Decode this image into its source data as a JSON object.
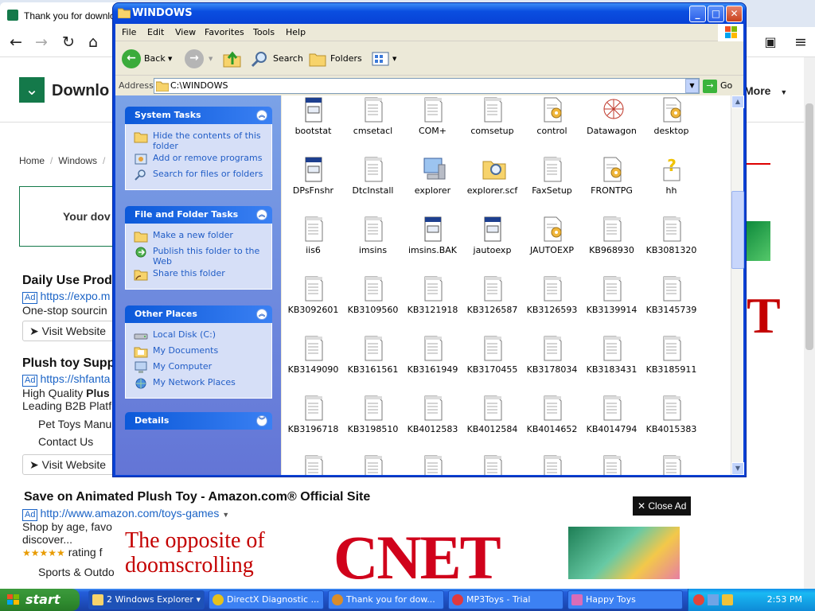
{
  "browser": {
    "tab_title": "Thank you for downloa",
    "logo_text": "Downlo",
    "more_label": "More",
    "breadcrumb": [
      "Home",
      "Windows"
    ],
    "download_box_text": "Your dov",
    "ads": [
      {
        "title": "Daily Use Prod",
        "url": "https://expo.m",
        "desc": "One-stop sourcin",
        "button": "Visit Website"
      },
      {
        "title": "Plush toy Supp",
        "url": "https://shfanta",
        "desc1_prefix": "High Quality ",
        "desc1_bold": "Plus",
        "desc2": "Leading B2B Platf",
        "link1": "Pet Toys Manu",
        "link2": "Contact Us",
        "button": "Visit Website"
      },
      {
        "title": "Save on Animated Plush Toy - Amazon.com® Official Site",
        "url": "http://www.amazon.com/toys-games",
        "desc1": "Shop by age, favo",
        "desc2": "discover...",
        "rating": "★★★★★",
        "rating_text": "rating f",
        "link1": "Sports & Outdo"
      }
    ],
    "close_ad": "Close Ad",
    "cnet_tagline_1": "The opposite of",
    "cnet_tagline_2": "doomscrolling",
    "cnet_logo": "CNET"
  },
  "explorer": {
    "title": "WINDOWS",
    "menu": [
      "File",
      "Edit",
      "View",
      "Favorites",
      "Tools",
      "Help"
    ],
    "toolbar": {
      "back": "Back",
      "search": "Search",
      "folders": "Folders"
    },
    "address_label": "Address",
    "address_value": "C:\\WINDOWS",
    "go_label": "Go",
    "system_tasks": {
      "title": "System Tasks",
      "items": [
        "Hide the contents of this folder",
        "Add or remove programs",
        "Search for files or folders"
      ]
    },
    "file_folder_tasks": {
      "title": "File and Folder Tasks",
      "items": [
        "Make a new folder",
        "Publish this folder to the Web",
        "Share this folder"
      ]
    },
    "other_places": {
      "title": "Other Places",
      "items": [
        "Local Disk (C:)",
        "My Documents",
        "My Computer",
        "My Network Places"
      ]
    },
    "details": {
      "title": "Details"
    },
    "files": [
      {
        "name": "bootstat",
        "icon": "log-file-icon"
      },
      {
        "name": "cmsetacl",
        "icon": "text-file-icon"
      },
      {
        "name": "COM+",
        "icon": "text-file-icon"
      },
      {
        "name": "comsetup",
        "icon": "text-file-icon"
      },
      {
        "name": "control",
        "icon": "settings-file-icon"
      },
      {
        "name": "Datawagon",
        "icon": "datawagon-icon"
      },
      {
        "name": "desktop",
        "icon": "settings-file-icon"
      },
      {
        "name": "DPsFnshr",
        "icon": "log-file-icon"
      },
      {
        "name": "DtcInstall",
        "icon": "text-file-icon"
      },
      {
        "name": "explorer",
        "icon": "computer-icon"
      },
      {
        "name": "explorer.scf",
        "icon": "search-folder-icon"
      },
      {
        "name": "FaxSetup",
        "icon": "text-file-icon"
      },
      {
        "name": "FRONTPG",
        "icon": "settings-file-icon"
      },
      {
        "name": "hh",
        "icon": "help-icon"
      },
      {
        "name": "iis6",
        "icon": "text-file-icon"
      },
      {
        "name": "imsins",
        "icon": "text-file-icon"
      },
      {
        "name": "imsins.BAK",
        "icon": "log-file-icon"
      },
      {
        "name": "jautoexp",
        "icon": "log-file-icon"
      },
      {
        "name": "JAUTOEXP",
        "icon": "settings-file-icon"
      },
      {
        "name": "KB968930",
        "icon": "text-file-icon"
      },
      {
        "name": "KB3081320",
        "icon": "text-file-icon"
      },
      {
        "name": "KB3092601",
        "icon": "text-file-icon"
      },
      {
        "name": "KB3109560",
        "icon": "text-file-icon"
      },
      {
        "name": "KB3121918",
        "icon": "text-file-icon"
      },
      {
        "name": "KB3126587",
        "icon": "text-file-icon"
      },
      {
        "name": "KB3126593",
        "icon": "text-file-icon"
      },
      {
        "name": "KB3139914",
        "icon": "text-file-icon"
      },
      {
        "name": "KB3145739",
        "icon": "text-file-icon"
      },
      {
        "name": "KB3149090",
        "icon": "text-file-icon"
      },
      {
        "name": "KB3161561",
        "icon": "text-file-icon"
      },
      {
        "name": "KB3161949",
        "icon": "text-file-icon"
      },
      {
        "name": "KB3170455",
        "icon": "text-file-icon"
      },
      {
        "name": "KB3178034",
        "icon": "text-file-icon"
      },
      {
        "name": "KB3183431",
        "icon": "text-file-icon"
      },
      {
        "name": "KB3185911",
        "icon": "text-file-icon"
      },
      {
        "name": "KB3196718",
        "icon": "text-file-icon"
      },
      {
        "name": "KB3198510",
        "icon": "text-file-icon"
      },
      {
        "name": "KB4012583",
        "icon": "text-file-icon"
      },
      {
        "name": "KB4012584",
        "icon": "text-file-icon"
      },
      {
        "name": "KB4014652",
        "icon": "text-file-icon"
      },
      {
        "name": "KB4014794",
        "icon": "text-file-icon"
      },
      {
        "name": "KB4015383",
        "icon": "text-file-icon"
      },
      {
        "name": "",
        "icon": "text-file-icon"
      },
      {
        "name": "",
        "icon": "text-file-icon"
      },
      {
        "name": "",
        "icon": "text-file-icon"
      },
      {
        "name": "",
        "icon": "text-file-icon"
      },
      {
        "name": "",
        "icon": "text-file-icon"
      },
      {
        "name": "",
        "icon": "text-file-icon"
      },
      {
        "name": "",
        "icon": "text-file-icon"
      }
    ]
  },
  "taskbar": {
    "start_label": "start",
    "tasks": [
      {
        "label": "2 Windows Explorer",
        "icon": "folder-icon"
      },
      {
        "label": "DirectX Diagnostic ...",
        "icon": "directx-icon"
      },
      {
        "label": "Thank you for dow...",
        "icon": "browser-icon"
      },
      {
        "label": "MP3Toys - Trial",
        "icon": "mp3toys-icon"
      },
      {
        "label": "Happy Toys",
        "icon": "happytoys-icon"
      }
    ],
    "clock": "2:53 PM"
  },
  "colors": {
    "xp_blue": "#0842d6",
    "task_pane_link": "#215dc6",
    "start_green": "#3c9a3c",
    "cnet_red": "#d0021b",
    "download_green": "#14794a"
  }
}
